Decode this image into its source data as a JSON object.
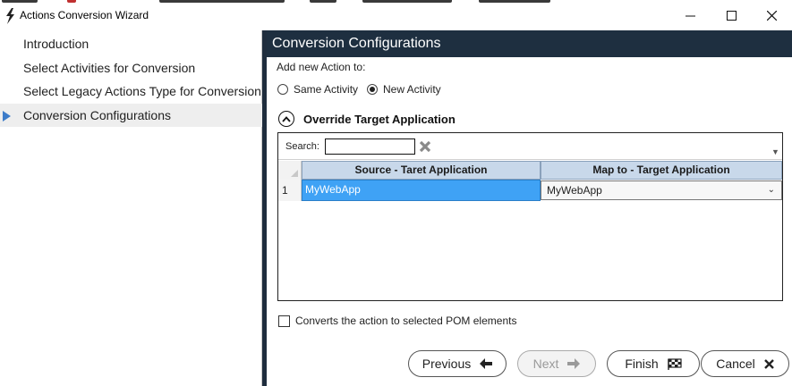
{
  "window": {
    "title": "Actions Conversion Wizard",
    "minimize_icon": "minimize-icon",
    "maximize_icon": "maximize-icon",
    "close_icon": "close-icon"
  },
  "nav": {
    "items": [
      {
        "label": "Introduction",
        "selected": false
      },
      {
        "label": "Select Activities for Conversion",
        "selected": false
      },
      {
        "label": "Select Legacy Actions Type for Conversion",
        "selected": false
      },
      {
        "label": "Conversion Configurations",
        "selected": true
      }
    ]
  },
  "header": {
    "title": "Conversion Configurations"
  },
  "add_action": {
    "label": "Add new Action to:",
    "options": [
      {
        "label": "Same Activity",
        "checked": false
      },
      {
        "label": "New Activity",
        "checked": true
      }
    ]
  },
  "section": {
    "title": "Override Target Application",
    "icon": "chevron-up-circle-icon"
  },
  "grid": {
    "search_label": "Search:",
    "search_value": "",
    "clear_icon": "clear-search-icon",
    "columns": [
      "Source - Taret Application",
      "Map to - Target Application"
    ],
    "rows": [
      {
        "index": "1",
        "source": "MyWebApp",
        "target": "MyWebApp"
      }
    ]
  },
  "pom_checkbox": {
    "label": "Converts the action to selected POM elements",
    "checked": false
  },
  "buttons": {
    "previous": "Previous",
    "next": "Next",
    "finish": "Finish",
    "cancel": "Cancel"
  },
  "colors": {
    "header_bg": "#1e2f40",
    "selected_cell": "#3fa2f5",
    "nav_arrow": "#3d7cc9",
    "column_header": "#c8d8ea"
  }
}
